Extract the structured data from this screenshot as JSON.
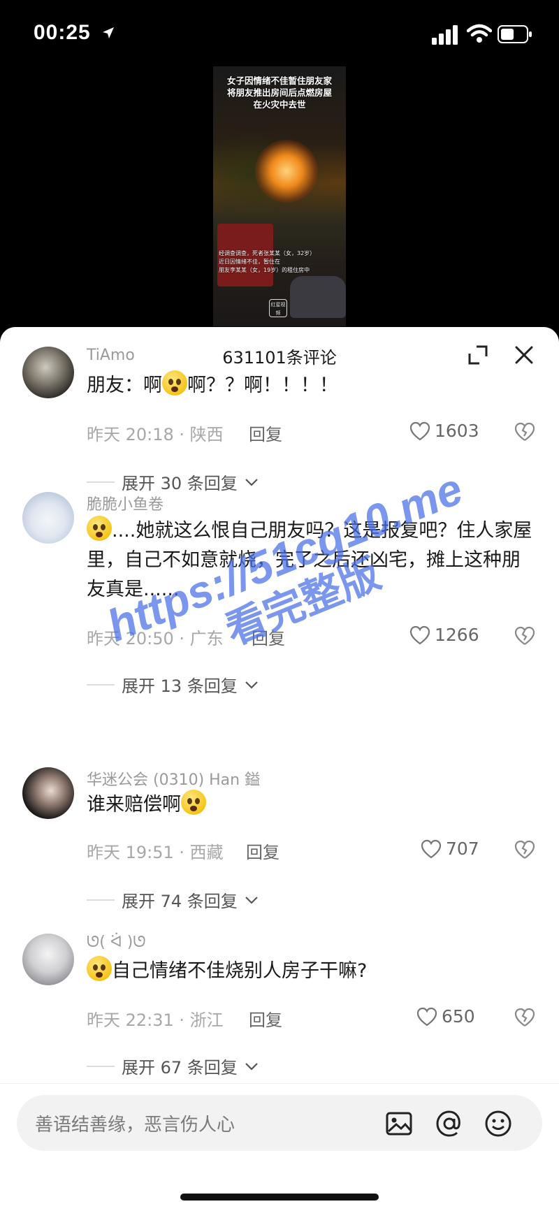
{
  "status": {
    "time": "00:25"
  },
  "video": {
    "title_lines": [
      "女子因情绪不佳暂住朋友家",
      "将朋友推出房间后点燃房屋",
      "在火灾中去世"
    ],
    "caption_lines": [
      "经调查调查，死者张某某（女，32岁）",
      "近日因情绪不佳，暂住在",
      "朋友李某某（女，19岁）的租住房中"
    ],
    "logo_text": "红星视频"
  },
  "sheet": {
    "title": "631101条评论"
  },
  "comments": [
    {
      "username": "TiAmo",
      "text_parts": [
        "朋友：啊",
        "啊？？啊！！！！"
      ],
      "time_loc": "昨天 20:18 · 陕西",
      "reply": "回复",
      "likes": "1603",
      "expand": "展开 30 条回复"
    },
    {
      "username": "脆脆小鱼卷",
      "text_parts": [
        "",
        "....她就这么恨自己朋友吗？这是报复吧？住人家屋里，自己不如意就烧，完了之后还凶宅，摊上这种朋友真是......"
      ],
      "time_loc": "昨天 20:50 · 广东",
      "reply": "回复",
      "likes": "1266",
      "expand": "展开 13 条回复"
    },
    {
      "username": "华迷公会 (0310)  Han 鎰",
      "text_parts": [
        "谁来赔偿啊",
        ""
      ],
      "time_loc": "昨天 19:51 · 西藏",
      "reply": "回复",
      "likes": "707",
      "expand": "展开 74 条回复"
    },
    {
      "username": "ᘎ( ᐛ )ᘎ",
      "text_parts": [
        "",
        "自己情绪不佳烧别人房子干嘛?"
      ],
      "time_loc": "昨天 22:31 · 浙江",
      "reply": "回复",
      "likes": "650",
      "expand": "展开 67 条回复"
    }
  ],
  "watermark": {
    "line1": "https://51cg10.me",
    "line2": "看完整版"
  },
  "input": {
    "placeholder": "善语结善缘，恶言伤人心"
  }
}
